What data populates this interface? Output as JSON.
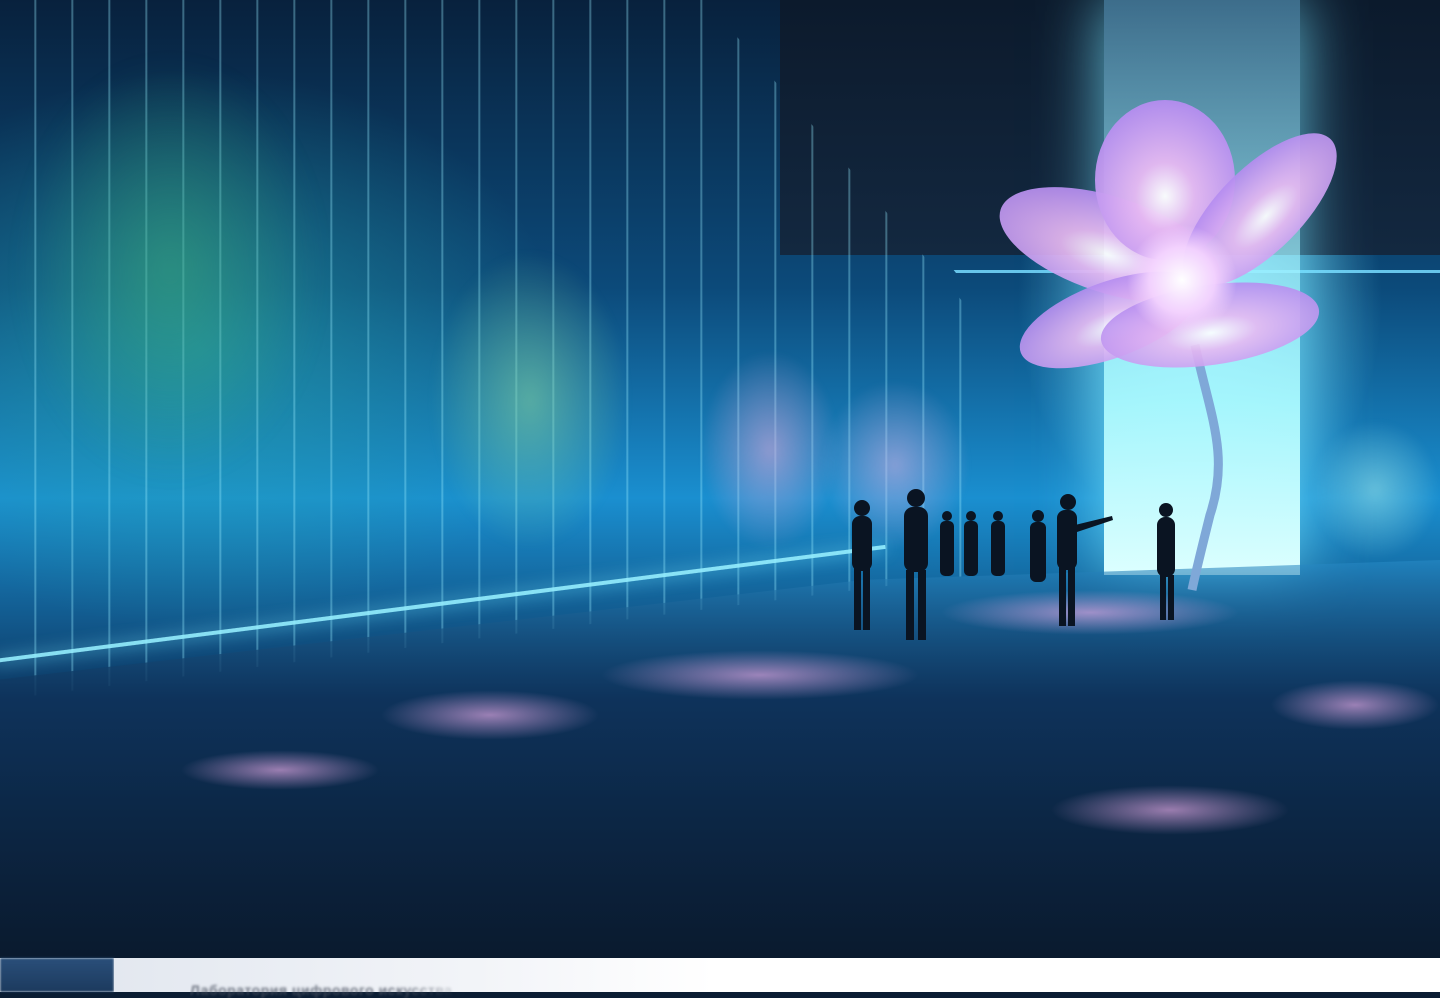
{
  "hero": {
    "image_alt": "",
    "colors": {
      "accent_cyan": "#5fd8ff",
      "flower_violet": "#c79cf2",
      "floor_dark": "#0a1a2e"
    },
    "icons": [
      "flower-illustration",
      "people-silhouettes"
    ]
  },
  "footer_card": {
    "text": "Лаборатория цифрового искусства ..."
  }
}
